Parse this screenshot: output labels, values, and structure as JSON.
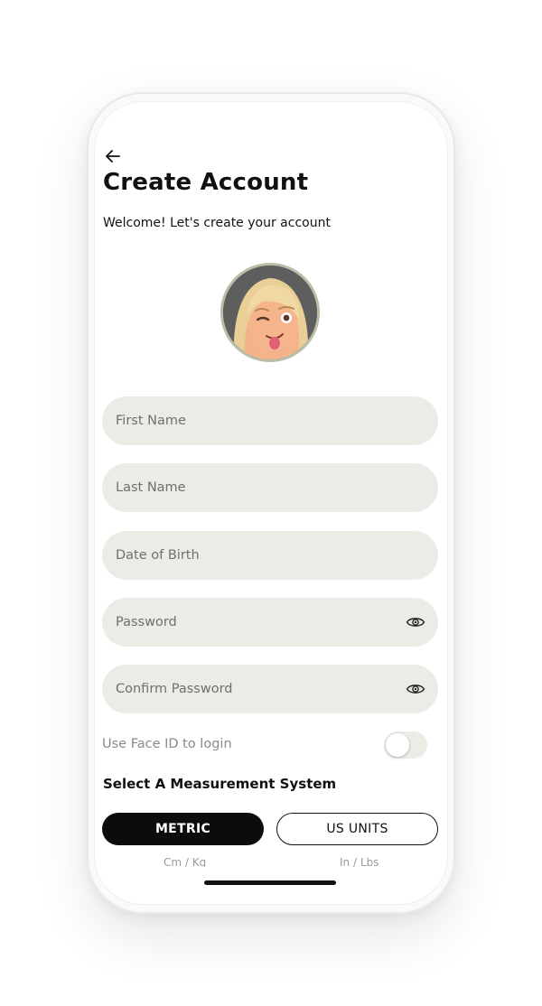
{
  "header": {
    "back_icon": "arrow-left-icon",
    "title": "Create Account",
    "subtitle": "Welcome! Let's create your account"
  },
  "avatar": {
    "icon": "memoji-avatar"
  },
  "form": {
    "first_name_placeholder": "First Name",
    "last_name_placeholder": "Last Name",
    "dob_placeholder": "Date of Birth",
    "password_placeholder": "Password",
    "confirm_password_placeholder": "Confirm Password",
    "show_password_icon": "eye-icon"
  },
  "face_id": {
    "label": "Use Face ID to login",
    "enabled": false
  },
  "measurement": {
    "heading": "Select A Measurement System",
    "options": [
      {
        "label": "METRIC",
        "sub": "Cm / Kg",
        "selected": true
      },
      {
        "label": "US UNITS",
        "sub": "In / Lbs",
        "selected": false
      }
    ]
  },
  "colors": {
    "field_bg": "#ecebe6",
    "accent": "#0c0c0c",
    "avatar_ring": "#b9bea6"
  }
}
